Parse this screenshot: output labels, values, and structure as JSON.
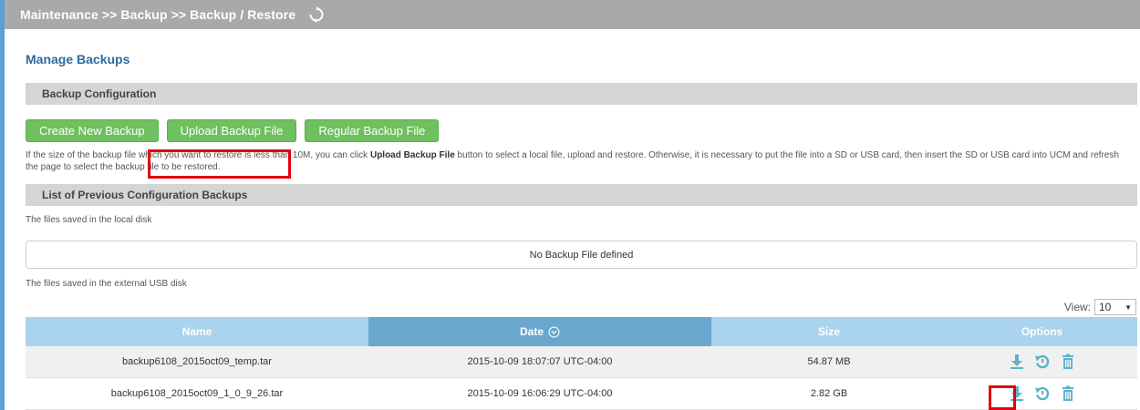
{
  "breadcrumb": {
    "text": "Maintenance >> Backup >> Backup / Restore",
    "refresh_icon": "refresh-icon"
  },
  "page_title": "Manage Backups",
  "backup_configuration": {
    "title": "Backup Configuration",
    "buttons": {
      "create": "Create New Backup",
      "upload": "Upload Backup File",
      "regular": "Regular Backup File"
    },
    "info": {
      "part1": "If the size of the backup file which you want to restore is less than 10M, you can click ",
      "bold": "Upload Backup File",
      "part2": " button to select a local file, upload and restore. Otherwise, it is necessary to put the file into a SD or USB card, then insert the SD or USB card into UCM and refresh the page to select the backup file to be restored."
    }
  },
  "previous_backups": {
    "title": "List of Previous Configuration Backups",
    "local_label": "The files saved in the local disk",
    "local_empty": "No Backup File defined",
    "usb_label": "The files saved in the external USB disk",
    "view": {
      "label": "View:",
      "value": "10"
    },
    "columns": {
      "name": "Name",
      "date": "Date",
      "size": "Size",
      "options": "Options"
    },
    "rows": [
      {
        "name": "backup6108_2015oct09_temp.tar",
        "date": "2015-10-09 18:07:07 UTC-04:00",
        "size": "54.87 MB"
      },
      {
        "name": "backup6108_2015oct09_1_0_9_26.tar",
        "date": "2015-10-09 16:06:29 UTC-04:00",
        "size": "2.82 GB"
      }
    ],
    "option_icons": [
      "download-icon",
      "restore-icon",
      "delete-icon"
    ]
  },
  "colors": {
    "accent_blue": "#5a9fd6",
    "button_green": "#6fc05f",
    "header_blue": "#a9d3ee",
    "active_header": "#6aa7cf",
    "highlight_red": "#e3000f",
    "icon_teal": "#5ab4c9"
  }
}
